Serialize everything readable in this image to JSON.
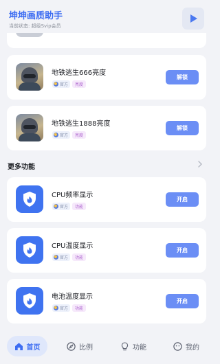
{
  "header": {
    "title": "坤坤画质助手",
    "status_label": "当前状态:",
    "status_value": "超级Svip会员"
  },
  "list": [
    {
      "title": "地铁逃生666亮度",
      "official": "官方",
      "tag": "亮度",
      "button": "解锁",
      "icon": "game-thumbnail"
    },
    {
      "title": "地铁逃生1888亮度",
      "official": "官方",
      "tag": "亮度",
      "button": "解锁",
      "icon": "game-thumbnail"
    }
  ],
  "more_section": {
    "title": "更多功能",
    "items": [
      {
        "title": "CPU频率显示",
        "official": "官方",
        "tag": "功能",
        "button": "开启",
        "icon": "shield-flame-icon"
      },
      {
        "title": "CPU温度显示",
        "official": "官方",
        "tag": "功能",
        "button": "开启",
        "icon": "shield-flame-icon"
      },
      {
        "title": "电池温度显示",
        "official": "官方",
        "tag": "功能",
        "button": "开启",
        "icon": "shield-flame-icon"
      }
    ]
  },
  "nav": [
    {
      "label": "首页",
      "icon": "home-icon",
      "active": true
    },
    {
      "label": "比例",
      "icon": "compass-icon",
      "active": false
    },
    {
      "label": "功能",
      "icon": "bulb-icon",
      "active": false
    },
    {
      "label": "我的",
      "icon": "smile-icon",
      "active": false
    }
  ],
  "colors": {
    "accent": "#3d6df2",
    "button": "#6b8ef5",
    "background": "#f2f3f7",
    "tag_purple": "#b06ad0"
  }
}
